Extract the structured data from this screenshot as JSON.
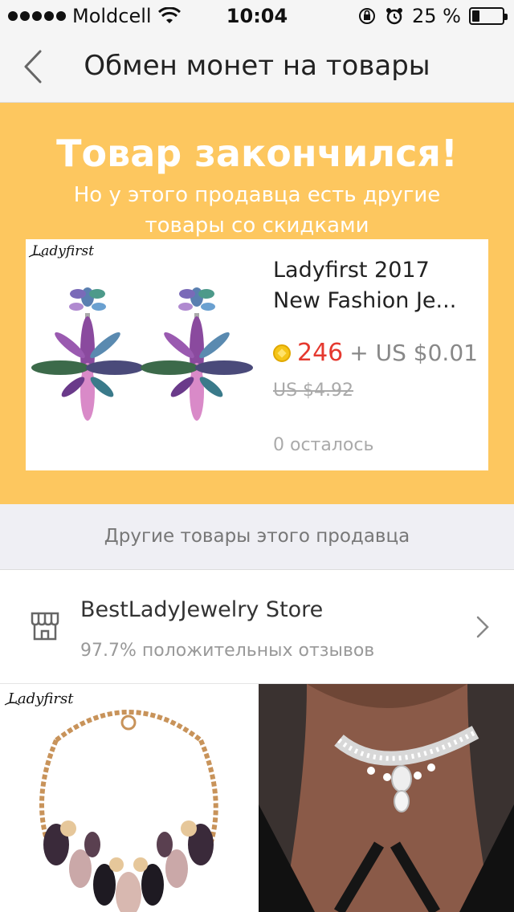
{
  "status_bar": {
    "carrier": "Moldcell",
    "time": "10:04",
    "battery_text": "25 %",
    "battery_level": 0.25
  },
  "nav": {
    "title": "Обмен монет на товары"
  },
  "banner": {
    "title": "Товар закончился!",
    "subtitle": "Но у этого продавца есть другие товары со скидками",
    "product": {
      "brand": "Ladyfirst",
      "name": "Ladyfirst 2017 New Fashion Je...",
      "coins": "246",
      "usd_extra": "+ US $0.01",
      "old_price": "US $4.92",
      "remaining": "0 осталось"
    }
  },
  "section": {
    "other_products_label": "Другие товары этого продавца"
  },
  "store": {
    "name": "BestLadyJewelry Store",
    "rating": "97.7% положительных отзывов"
  },
  "grid": {
    "items": [
      {
        "brand": "Ladyfirst"
      },
      {
        "brand": ""
      }
    ]
  },
  "colors": {
    "banner": "#fdc75f",
    "price_red": "#e5392f"
  }
}
